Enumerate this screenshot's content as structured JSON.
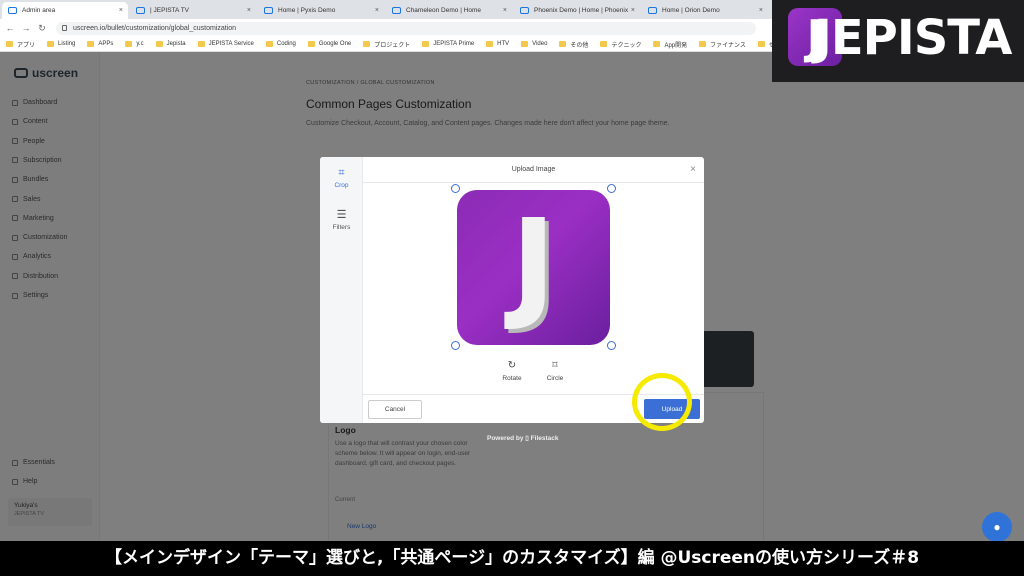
{
  "browser": {
    "tabs": [
      {
        "label": "Admin area",
        "active": true
      },
      {
        "label": "| JEPISTA TV",
        "active": false
      },
      {
        "label": "Home | Pyxis Demo",
        "active": false
      },
      {
        "label": "Chameleon Demo | Home",
        "active": false
      },
      {
        "label": "Phoenix Demo | Home | Phoenix",
        "active": false
      },
      {
        "label": "Home | Orion Demo",
        "active": false
      }
    ],
    "new_tab": "+",
    "url": "uscreen.io/bullet/customization/global_customization",
    "bookmarks": [
      "アプリ",
      "Listing",
      "APPs",
      "y.c",
      "Jepista",
      "JEPISTA Service",
      "Coding",
      "Google One",
      "プロジェクト",
      "JEPISTA Prime",
      "HTV",
      "Video",
      "その他",
      "テクニック",
      "App開発",
      "ファイナンス",
      "セブ"
    ]
  },
  "sidebar": {
    "logo": "uscreen",
    "items": [
      "Dashboard",
      "Content",
      "People",
      "Subscription",
      "Bundles",
      "Sales",
      "Marketing",
      "Customization",
      "Analytics",
      "Distribution",
      "Settings"
    ],
    "bottom_items": [
      "Essentials",
      "Help"
    ],
    "user_name": "Yukiya's",
    "user_sub": "JEPISTA TV"
  },
  "page": {
    "breadcrumb": "CUSTOMIZATION / GLOBAL CUSTOMIZATION",
    "title": "Common Pages Customization",
    "description": "Customize Checkout, Account, Catalog, and Content pages. Changes made here don't affect your home page theme.",
    "logo_title": "Logo",
    "logo_desc": "Use a logo that will contrast your chosen color scheme below. It will appear on login, end-user dashboard, gift card, and checkout pages.",
    "logo_current": "Current",
    "logo_button": "New Logo"
  },
  "modal": {
    "title": "Upload Image",
    "close": "×",
    "tools": [
      {
        "label": "Crop",
        "icon": "crop-icon",
        "glyph": "⌗",
        "active": true
      },
      {
        "label": "Filters",
        "icon": "sliders-icon",
        "glyph": "☰",
        "active": false
      }
    ],
    "actions": [
      {
        "label": "Rotate",
        "icon": "rotate-icon",
        "glyph": "↻"
      },
      {
        "label": "Circle",
        "icon": "circle-crop-icon",
        "glyph": "⌑"
      }
    ],
    "cancel": "Cancel",
    "upload": "Upload",
    "image_letter": "J",
    "powered_by": "Powered by ▯ Filestack"
  },
  "overlay_brand": {
    "text": "JEPISTA",
    "icon_letter": "J"
  },
  "caption": "【メインデザイン「テーマ」選びと,「共通ページ」のカスタマイズ】編 @Uscreenの使い方シリーズ＃8",
  "colors": {
    "accent": "#3b6fd6",
    "purple": "#8b2bb5",
    "highlight": "#f5ea00"
  }
}
